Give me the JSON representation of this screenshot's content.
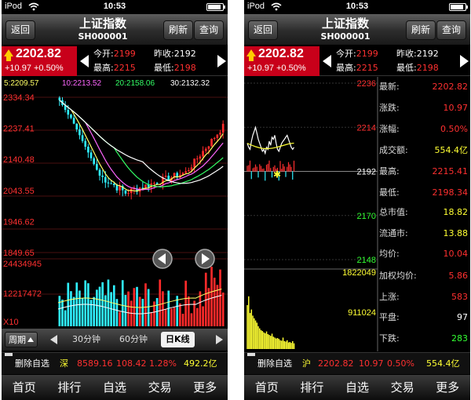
{
  "status": {
    "carrier": "iPod",
    "time": "10:53"
  },
  "nav": {
    "back": "返回",
    "title": "上证指数",
    "code": "SH000001",
    "refresh": "刷新",
    "query": "查询"
  },
  "quote": {
    "price": "2202.82",
    "change": "+10.97 +0.50%",
    "open_label": "今开:",
    "open": "2199",
    "prev_label": "昨收:",
    "prev": "2192",
    "high_label": "最高:",
    "high": "2215",
    "low_label": "最低:",
    "low": "2198"
  },
  "ma": [
    {
      "text": "5:2209.57",
      "color": "#ffff66"
    },
    {
      "text": "10:2213.52",
      "color": "#ff66ff"
    },
    {
      "text": "20:2158.06",
      "color": "#33ff66"
    },
    {
      "text": "30:2132.32",
      "color": "#ffffff"
    }
  ],
  "kchart": {
    "price_ticks": [
      "2334.34",
      "2237.41",
      "2140.48",
      "2043.55",
      "1946.62",
      "1849.65"
    ],
    "price_range": [
      1849.65,
      2334.34
    ],
    "volume_ticks": [
      "24434945",
      "12217472",
      "X10"
    ],
    "volume_max": 24434945,
    "colors": {
      "up": "#ff2a2a",
      "down": "#2ff0ff",
      "ma5": "#ffff66",
      "ma10": "#ff66ff",
      "ma20": "#33ff66",
      "ma30": "#ffffff"
    }
  },
  "periods": {
    "main": "周期",
    "p30": "30分钟",
    "p60": "60分钟",
    "day": "日K线"
  },
  "info_left": {
    "remove": "删除自选",
    "market": "深",
    "index": "8589.16",
    "change": "108.42",
    "pct": "1.28%",
    "turnover": "492.2亿"
  },
  "info_right": {
    "remove": "删除自选",
    "market": "沪",
    "index": "2202.82",
    "change": "10.97",
    "pct": "0.50%",
    "turnover": "554.4亿"
  },
  "tabs": [
    "首页",
    "排行",
    "自选",
    "交易",
    "更多"
  ],
  "tchart": {
    "price_ticks": [
      "2236",
      "2214",
      "2192",
      "2170",
      "2148"
    ],
    "price_range": [
      2148,
      2236
    ],
    "volume_ticks": [
      "1822049",
      "911024"
    ],
    "volume_max": 1822049
  },
  "detail": [
    {
      "label": "最新:",
      "value": "2202.82",
      "color": "#ff3030"
    },
    {
      "label": "涨跌:",
      "value": "10.97",
      "color": "#ff3030"
    },
    {
      "label": "涨幅:",
      "value": "0.50%",
      "color": "#ff3030"
    },
    {
      "label": "成交额:",
      "value": "554.4亿",
      "color": "#ffff33"
    },
    {
      "label": "最高:",
      "value": "2215.41",
      "color": "#ff3030"
    },
    {
      "label": "最低:",
      "value": "2198.34",
      "color": "#ff3030"
    },
    {
      "label": "总市值:",
      "value": "18.82",
      "color": "#ffff33"
    },
    {
      "label": "流通市:",
      "value": "13.88",
      "color": "#ffff33"
    },
    {
      "label": "均价:",
      "value": "10.04",
      "color": "#ff3030"
    },
    {
      "label": "加权均价:",
      "value": "5.86",
      "color": "#ff3030"
    },
    {
      "label": "上涨:",
      "value": "583",
      "color": "#ff3030"
    },
    {
      "label": "平盘:",
      "value": "97",
      "color": "#ffffff"
    },
    {
      "label": "下跌:",
      "value": "283",
      "color": "#33ff33"
    }
  ]
}
